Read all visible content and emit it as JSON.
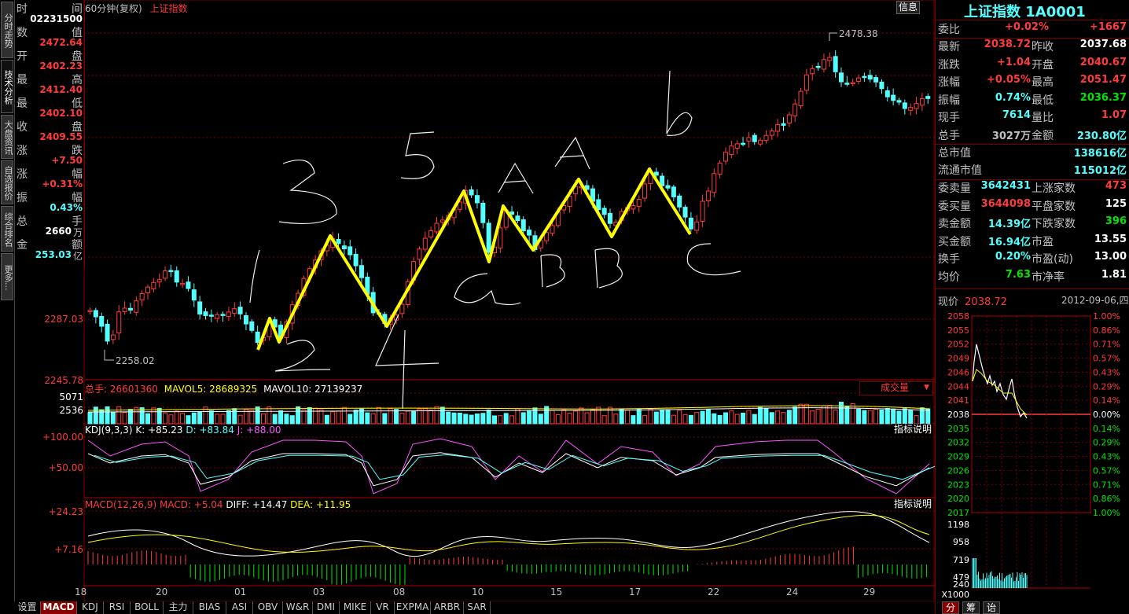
{
  "header": {
    "period_label": "60分钟(复权)",
    "index_name": "上证指数",
    "info_button": "信息"
  },
  "left_tabs": [
    "分时走势",
    "技术分析",
    "大盘资讯",
    "自选报价",
    "综合排名",
    "更多..."
  ],
  "info_column": {
    "rows": [
      {
        "label": "时",
        "label2": "间",
        "value": "02231500",
        "color": "white"
      },
      {
        "label": "数",
        "label2": "值",
        "value": "2472.64",
        "color": "red"
      },
      {
        "label": "开",
        "label2": "盘",
        "value": "2402.23",
        "color": "red"
      },
      {
        "label": "最",
        "label2": "高",
        "value": "2412.40",
        "color": "red"
      },
      {
        "label": "最",
        "label2": "低",
        "value": "2402.10",
        "color": "red"
      },
      {
        "label": "收",
        "label2": "盘",
        "value": "2409.55",
        "color": "red"
      },
      {
        "label": "涨",
        "label2": "跌",
        "value": "+7.50",
        "color": "red"
      },
      {
        "label": "涨",
        "label2": "幅",
        "value": "+0.31%",
        "color": "red"
      },
      {
        "label": "振",
        "label2": "幅",
        "value": "0.43%",
        "color": "cyan"
      },
      {
        "label": "总",
        "label2": "手",
        "value": "2660",
        "unit": "万",
        "color": "white"
      },
      {
        "label": "金",
        "label2": "额",
        "value": "253.03",
        "unit": "亿",
        "color": "cyan"
      }
    ]
  },
  "price_axis": {
    "labels": [
      {
        "text": "2287.03"
      },
      {
        "text": "2245.78"
      }
    ],
    "range": [
      2245.78,
      2478.38
    ]
  },
  "annotations": {
    "high_label": "2478.38",
    "low_label": "2258.02"
  },
  "volume_panel": {
    "title": "总手: 26601360",
    "mavol5": "MAVOL5: 28689325",
    "mavol10": "MAVOL10: 27139237",
    "axis": [
      "5071",
      "2536"
    ],
    "selector": "成交量"
  },
  "kdj_panel": {
    "title": "KDJ(9,3,3)",
    "k": "K: +85.23",
    "d": "D: +83.84",
    "j": "J: +88.00",
    "axis": [
      "+100.00",
      "+50.00"
    ],
    "button": "指标说明"
  },
  "macd_panel": {
    "title": "MACD(12,26,9)",
    "macd": "MACD: +5.04",
    "diff": "DIFF: +14.47",
    "dea": "DEA: +11.95",
    "axis": [
      "+24.23",
      "+7.16"
    ],
    "button": "指标说明"
  },
  "date_axis": [
    "18",
    "20",
    "01",
    "03",
    "08",
    "10",
    "15",
    "17",
    "22",
    "24",
    "29"
  ],
  "bottom_tabs": [
    "设置",
    "MACD",
    "KDJ",
    "RSI",
    "BOLL",
    "主力",
    "BIAS",
    "ASI",
    "OBV",
    "W&R",
    "DMI",
    "MIKE",
    "VR",
    "EXPMA",
    "ARBR",
    "SAR"
  ],
  "right_panel": {
    "title": "上证指数 1A0001",
    "weibi": {
      "label": "委比",
      "value": "+0.02%",
      "value2": "+1667"
    },
    "quote_rows": [
      {
        "l1": "最新",
        "v1": "2038.72",
        "c1": "red",
        "l2": "昨收",
        "v2": "2037.68",
        "c2": "white"
      },
      {
        "l1": "涨跌",
        "v1": "+1.04",
        "c1": "red",
        "l2": "开盘",
        "v2": "2040.67",
        "c2": "red"
      },
      {
        "l1": "涨幅",
        "v1": "+0.05%",
        "c1": "red",
        "l2": "最高",
        "v2": "2051.47",
        "c2": "red"
      },
      {
        "l1": "振幅",
        "v1": "0.74%",
        "c1": "cyan",
        "l2": "最低",
        "v2": "2036.37",
        "c2": "green"
      },
      {
        "l1": "现手",
        "v1": "7614",
        "c1": "cyan",
        "l2": "量比",
        "v2": "1.07",
        "c2": "red"
      },
      {
        "l1": "总手",
        "v1": "3027万",
        "c1": "gray",
        "l2": "金额",
        "v2": "230.80亿",
        "c2": "cyan"
      }
    ],
    "market_value": [
      {
        "label": "总市值",
        "value": "138616亿"
      },
      {
        "label": "流通市值",
        "value": "115012亿"
      }
    ],
    "order_rows": [
      {
        "l1": "委卖量",
        "v1": "3642431",
        "c1": "cyan",
        "l2": "上涨家数",
        "v2": "473",
        "c2": "red"
      },
      {
        "l1": "委买量",
        "v1": "3644098",
        "c1": "red",
        "l2": "平盘家数",
        "v2": "125",
        "c2": "white"
      },
      {
        "l1": "卖金额",
        "v1": "14.39亿",
        "c1": "cyan",
        "l2": "下跌家数",
        "v2": "396",
        "c2": "green"
      },
      {
        "l1": "买金额",
        "v1": "16.94亿",
        "c1": "cyan",
        "l2": "市盈",
        "v2": "13.55",
        "c2": "white"
      },
      {
        "l1": "换手",
        "v1": "0.20%",
        "c1": "cyan",
        "l2": "市盈(动)",
        "v2": "13.00",
        "c2": "white"
      },
      {
        "l1": "均价",
        "v1": "7.63",
        "c1": "green",
        "l2": "市净率",
        "v2": "1.81",
        "c2": "white"
      }
    ],
    "mini": {
      "label": "现价",
      "price": "2038.72",
      "date": "2012-09-06,四",
      "left_axis": [
        "2058",
        "2055",
        "2052",
        "2049",
        "2046",
        "2044",
        "2041",
        "2038",
        "2035",
        "2032",
        "2029",
        "2026",
        "2023",
        "2020",
        "2017"
      ],
      "right_axis": [
        "1.00%",
        "0.86%",
        "0.71%",
        "0.57%",
        "0.43%",
        "0.29%",
        "0.14%",
        "0.00%",
        "0.14%",
        "0.29%",
        "0.43%",
        "0.57%",
        "0.71%",
        "0.86%",
        "1.00%"
      ],
      "vol_axis": [
        "1198",
        "958",
        "719",
        "479",
        "240",
        "X1000"
      ]
    },
    "bottom_buttons": [
      "分",
      "筹",
      "诒"
    ]
  },
  "handwriting": [
    "3",
    "5",
    "A",
    "A",
    "b",
    "2",
    "4",
    "a",
    "B",
    "B",
    "C"
  ],
  "colors": {
    "up": "#ff3c3c",
    "down": "#54ffff",
    "bg": "#000000",
    "grid": "#7a0000",
    "wave": "#ffff00"
  }
}
